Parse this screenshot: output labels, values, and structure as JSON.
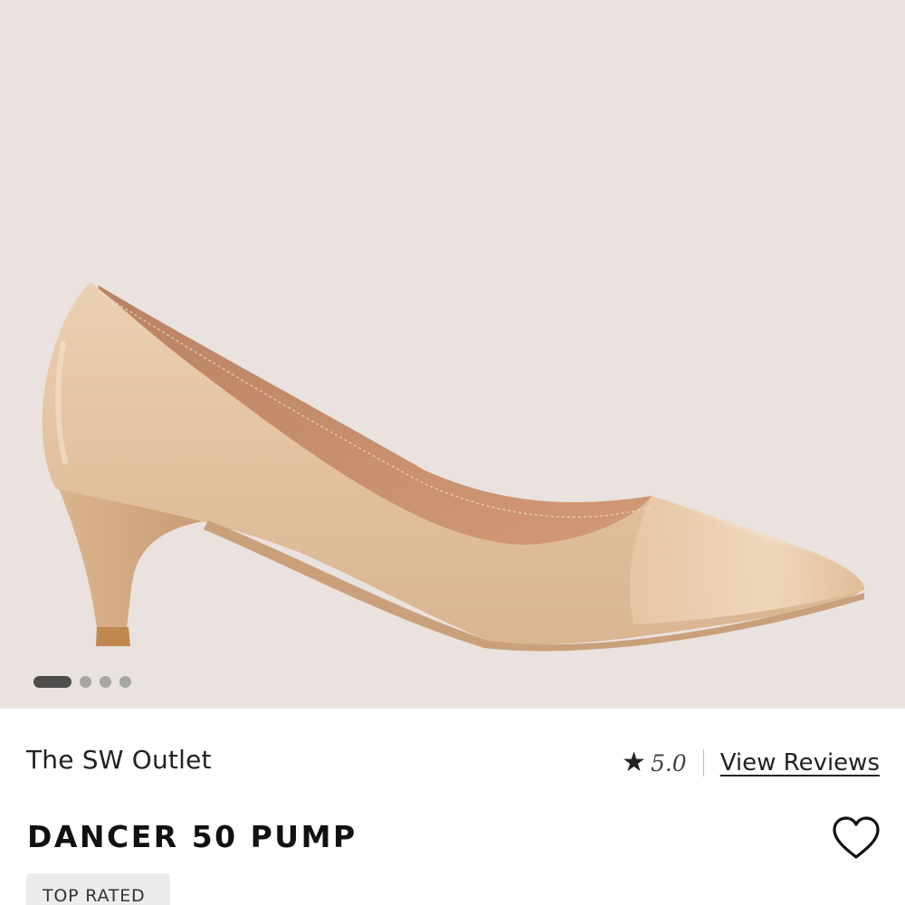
{
  "gallery": {
    "image_count": 4,
    "active_index": 0
  },
  "product": {
    "brand": "The SW Outlet",
    "rating": "5.0",
    "reviews_link": "View Reviews",
    "name": "DANCER 50 PUMP",
    "badge": "TOP RATED"
  },
  "icons": {
    "rating": "star-icon",
    "wishlist": "heart-icon"
  },
  "colors": {
    "hero_background": "#e9e2df",
    "shoe_primary": "#e4c4a2",
    "shoe_lining": "#c8906e",
    "heel_tip": "#c0874f",
    "text_primary": "#111111",
    "badge_background": "#ececec"
  }
}
